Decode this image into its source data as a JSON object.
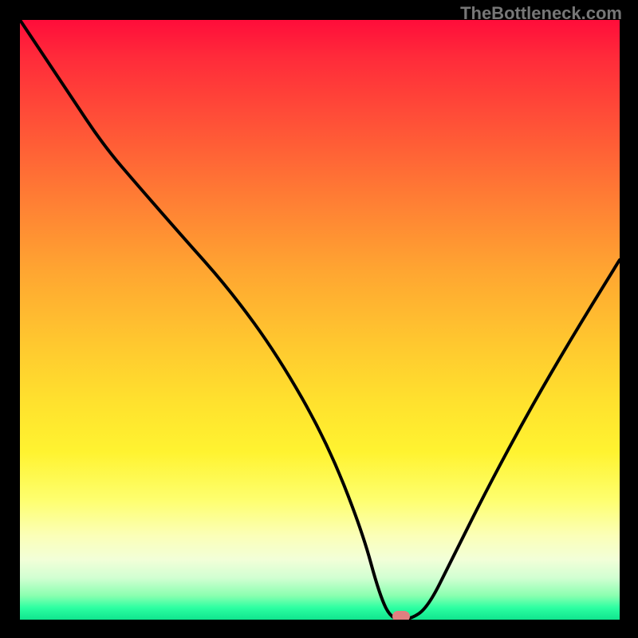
{
  "watermark": "TheBottleneck.com",
  "chart_data": {
    "type": "line",
    "title": "",
    "xlabel": "",
    "ylabel": "",
    "xlim": [
      0,
      100
    ],
    "ylim": [
      0,
      100
    ],
    "grid": false,
    "series": [
      {
        "name": "curve",
        "x": [
          0,
          8,
          14,
          20,
          27,
          35,
          43,
          51,
          57,
          60,
          62,
          65,
          68,
          72,
          78,
          85,
          92,
          100
        ],
        "y": [
          100,
          88,
          79,
          72,
          64,
          55,
          44,
          30,
          15,
          4,
          0,
          0,
          2,
          10,
          22,
          35,
          47,
          60
        ]
      }
    ],
    "marker": {
      "x": 63.5,
      "y": 0
    },
    "colors": {
      "curve": "#000000",
      "marker": "#e08080",
      "gradient_top": "#ff0d3a",
      "gradient_bottom": "#10e58e"
    }
  }
}
